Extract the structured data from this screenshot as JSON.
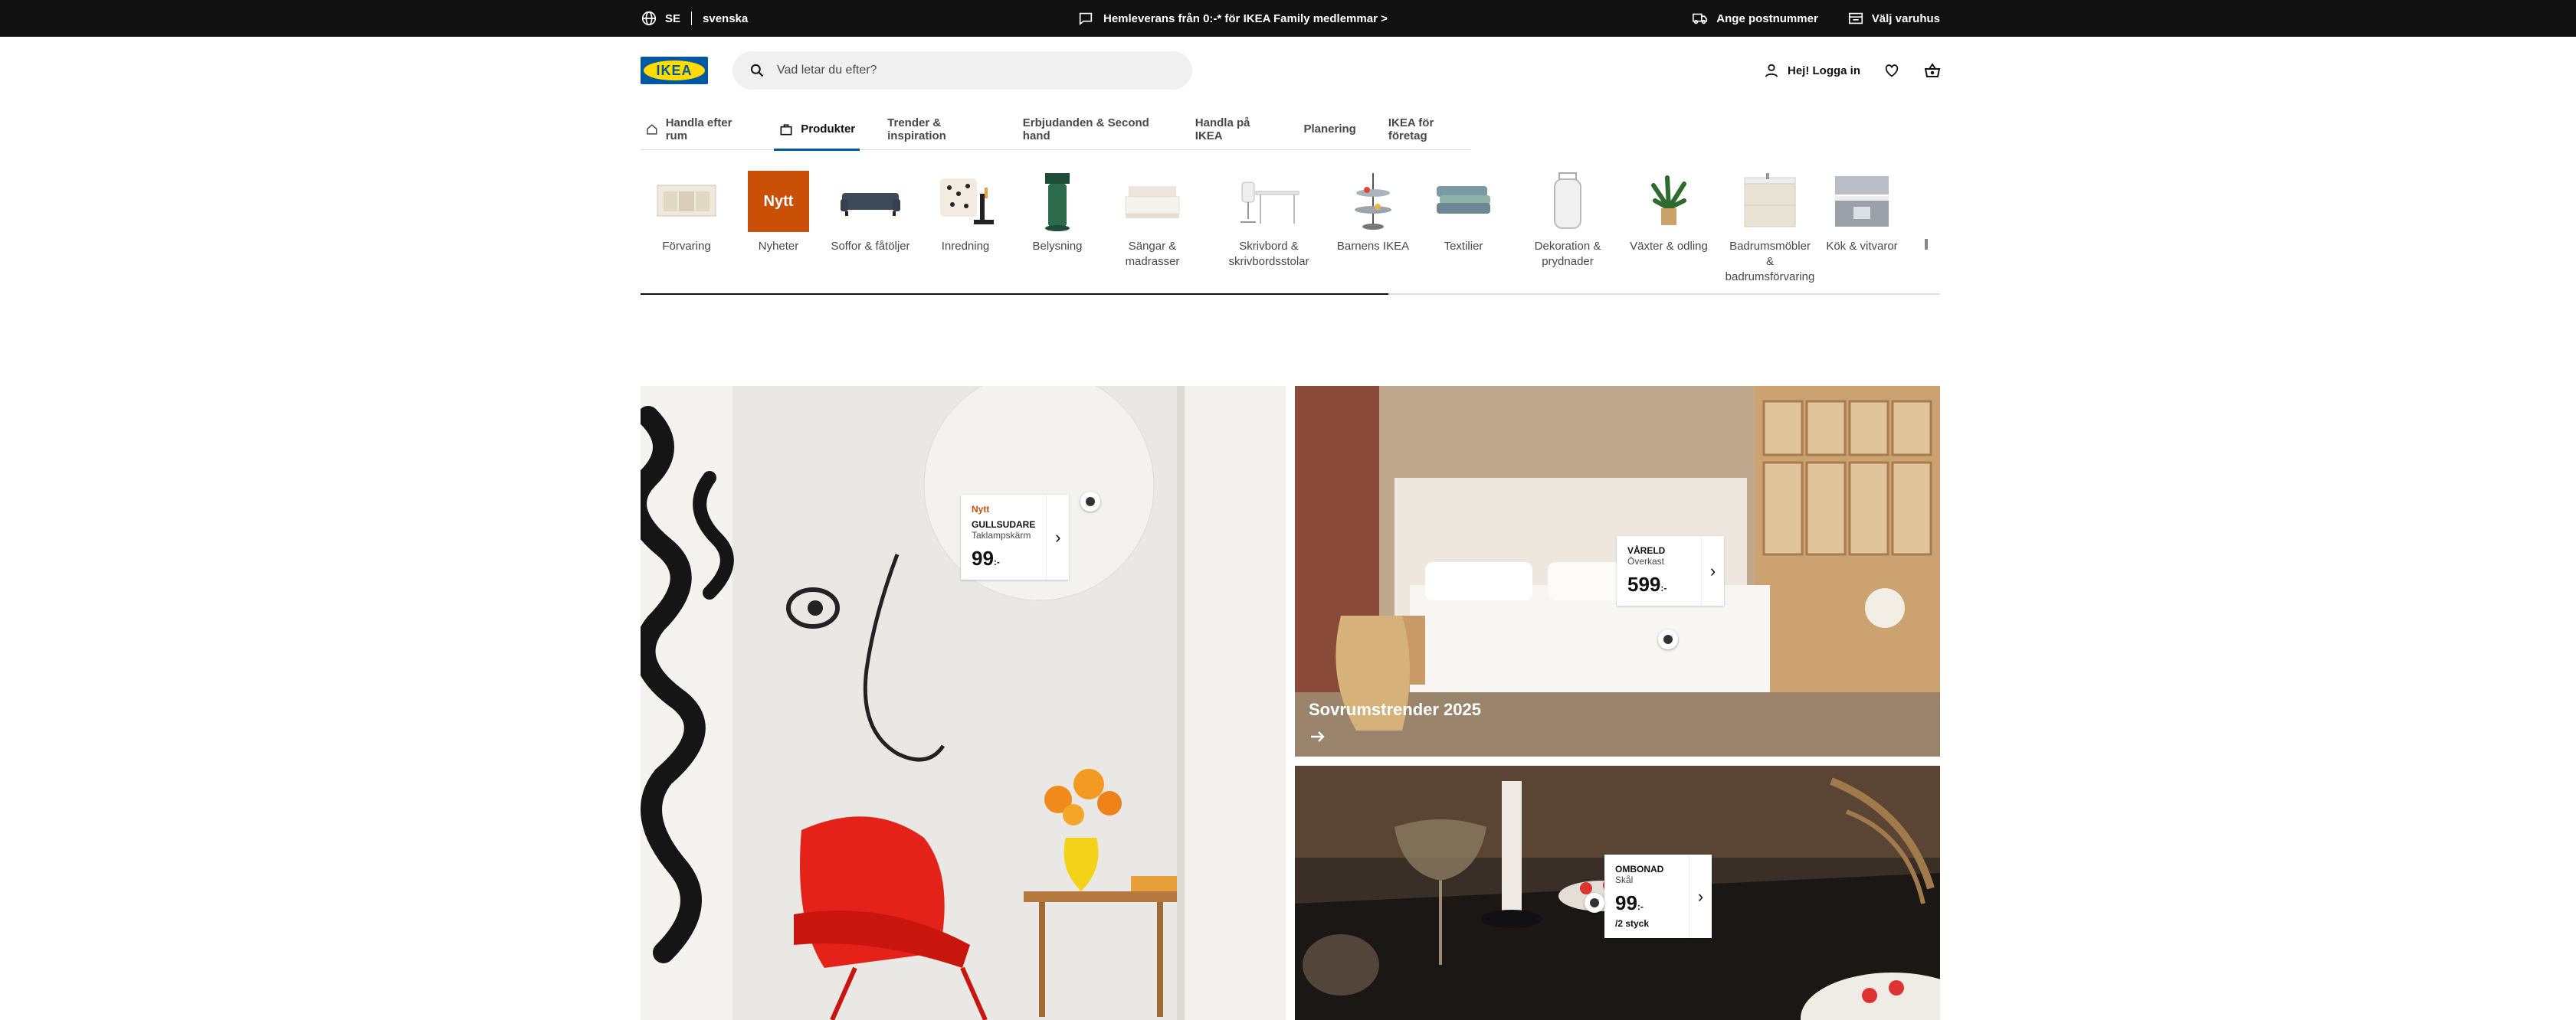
{
  "topbar": {
    "country": "SE",
    "language": "svenska",
    "promo": "Hemleverans från 0:-* för IKEA Family medlemmar >",
    "postcode": "Ange postnummer",
    "store": "Välj varuhus"
  },
  "header": {
    "logo_text": "IKEA",
    "search_placeholder": "Vad letar du efter?",
    "login": "Hej! Logga in"
  },
  "nav": {
    "tabs": [
      {
        "label": "Handla efter rum"
      },
      {
        "label": "Produkter"
      },
      {
        "label": "Trender & inspiration"
      },
      {
        "label": "Erbjudanden & Second hand"
      },
      {
        "label": "Handla på IKEA"
      },
      {
        "label": "Planering"
      },
      {
        "label": "IKEA för företag"
      }
    ]
  },
  "categories": [
    {
      "line1": "Förvaring",
      "line2": ""
    },
    {
      "line1": "Nyheter",
      "line2": ""
    },
    {
      "line1": "Soffor & fåtöljer",
      "line2": ""
    },
    {
      "line1": "Inredning",
      "line2": ""
    },
    {
      "line1": "Belysning",
      "line2": ""
    },
    {
      "line1": "Sängar &",
      "line2": "madrasser"
    },
    {
      "line1": "Skrivbord &",
      "line2": "skrivbordsstolar"
    },
    {
      "line1": "Barnens IKEA",
      "line2": ""
    },
    {
      "line1": "Textilier",
      "line2": ""
    },
    {
      "line1": "Dekoration &",
      "line2": "prydnader"
    },
    {
      "line1": "Växter & odling",
      "line2": ""
    },
    {
      "line1": "Badrumsmöbler &",
      "line2": "badrumsförvaring"
    },
    {
      "line1": "Kök & vitvaror",
      "line2": ""
    }
  ],
  "category_badge": "Nytt",
  "heroes": {
    "left_tag": {
      "badge": "Nytt",
      "name": "GULLSUDARE",
      "desc": "Taklampskärm",
      "price": "99",
      "suffix": ":-"
    },
    "right_top": {
      "caption": "Sovrumstrender 2025",
      "tag": {
        "name": "VÅRELD",
        "desc": "Överkast",
        "price": "599",
        "suffix": ":-"
      }
    },
    "right_bottom_tag": {
      "name": "OMBONAD",
      "desc": "Skål",
      "price": "99",
      "suffix": ":-",
      "unit": "/2 styck"
    }
  },
  "colors": {
    "ikea_blue": "#0058a3",
    "ikea_yellow": "#ffdb00",
    "new_orange": "#ca5008"
  }
}
